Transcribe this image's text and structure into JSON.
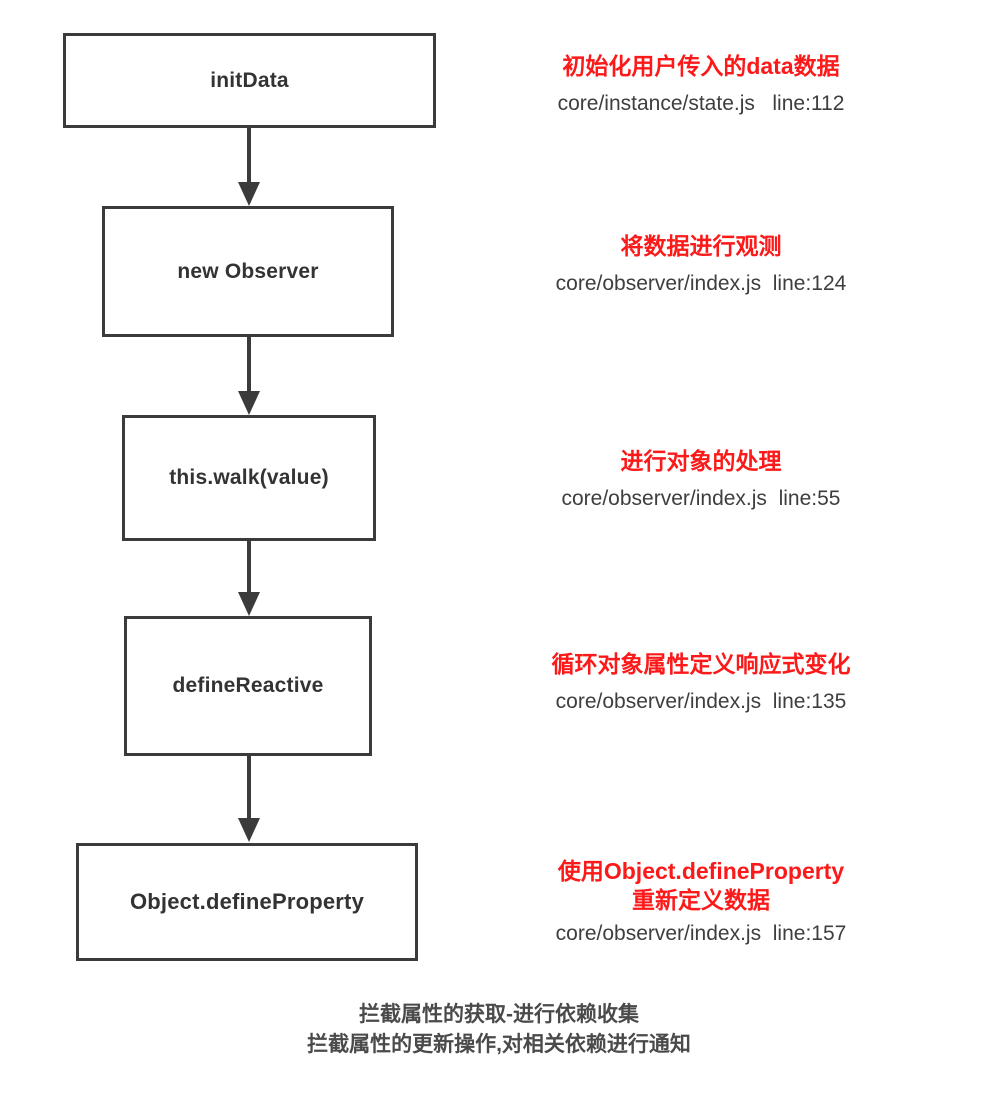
{
  "diagram": {
    "title_implicit": "Vue data reactivity flow",
    "nodes": [
      {
        "id": "init-data",
        "label": "initData"
      },
      {
        "id": "new-observer",
        "label": "new Observer"
      },
      {
        "id": "this-walk-value",
        "label": "this.walk(value)"
      },
      {
        "id": "define-reactive",
        "label": "defineReactive"
      },
      {
        "id": "object-defineproperty",
        "label": "Object.defineProperty"
      }
    ],
    "annotations": [
      {
        "title": "初始化用户传入的data数据",
        "source": "core/instance/state.js   line:112"
      },
      {
        "title": "将数据进行观测",
        "source": "core/observer/index.js  line:124"
      },
      {
        "title": "进行对象的处理",
        "source": "core/observer/index.js  line:55"
      },
      {
        "title": "循环对象属性定义响应式变化",
        "source": "core/observer/index.js  line:135"
      },
      {
        "title": "使用Object.defineProperty\n重新定义数据",
        "source": "core/observer/index.js  line:157"
      }
    ],
    "footer": {
      "line1": "拦截属性的获取-进行依赖收集",
      "line2": "拦截属性的更新操作,对相关依赖进行通知"
    },
    "colors": {
      "box_border": "#3b3b3b",
      "box_label": "#333333",
      "annotation_title": "#fb1919",
      "annotation_source": "#3e3e3e",
      "arrow": "#3b3b3b",
      "footer_text": "#4a4a4a",
      "background": "#ffffff"
    }
  }
}
